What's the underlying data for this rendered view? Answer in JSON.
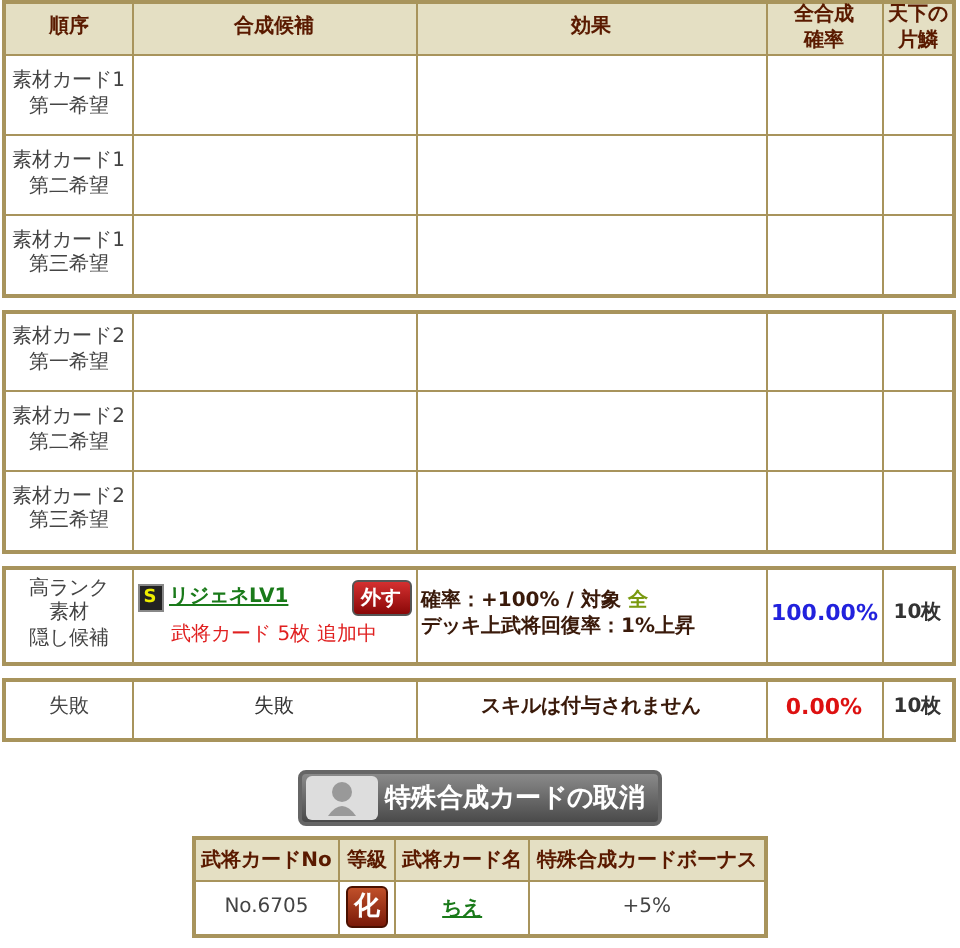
{
  "columns": [
    [
      "順序"
    ],
    [
      "合成候補"
    ],
    [
      "効果"
    ],
    [
      "全合成",
      "確率"
    ],
    [
      "天下の",
      "片鱗"
    ]
  ],
  "material_groups": [
    {
      "rows": [
        {
          "label": [
            "素材カード1",
            "第一希望"
          ]
        },
        {
          "label": [
            "素材カード1",
            "第二希望"
          ]
        },
        {
          "label": [
            "素材カード1",
            "第三希望"
          ]
        }
      ]
    },
    {
      "rows": [
        {
          "label": [
            "素材カード2",
            "第一希望"
          ]
        },
        {
          "label": [
            "素材カード2",
            "第二希望"
          ]
        },
        {
          "label": [
            "素材カード2",
            "第三希望"
          ]
        }
      ]
    }
  ],
  "results": [
    {
      "kind": "hidden",
      "label": [
        "高ランク",
        "素材",
        "隠し候補"
      ],
      "card": {
        "rank": "S",
        "name": "リジェネLV1",
        "note": "武将カード 5枚 追加中",
        "remove_button": "外す"
      },
      "effect": {
        "probability": "確率：+100%",
        "separator": "/",
        "target_label": "対象",
        "target": "全",
        "description": "デッキ上武将回復率：1%上昇"
      },
      "rate": "100.00%",
      "color": "#2222dd",
      "pieces": "10枚"
    },
    {
      "kind": "fail",
      "label": [
        "失敗"
      ],
      "candidate": "失敗",
      "effect_text": "スキルは付与されません",
      "rate": "0.00%",
      "color": "#dd1111",
      "pieces": "10枚"
    }
  ],
  "cancel_button": "特殊合成カードの取消",
  "bonus_table": {
    "columns": [
      "武将カードNo",
      "等級",
      "武将カード名",
      "特殊合成カードボーナス"
    ],
    "rows": [
      {
        "number": "No.6705",
        "grade": "化",
        "name": "ちえ",
        "bonus": "+5%"
      }
    ]
  }
}
